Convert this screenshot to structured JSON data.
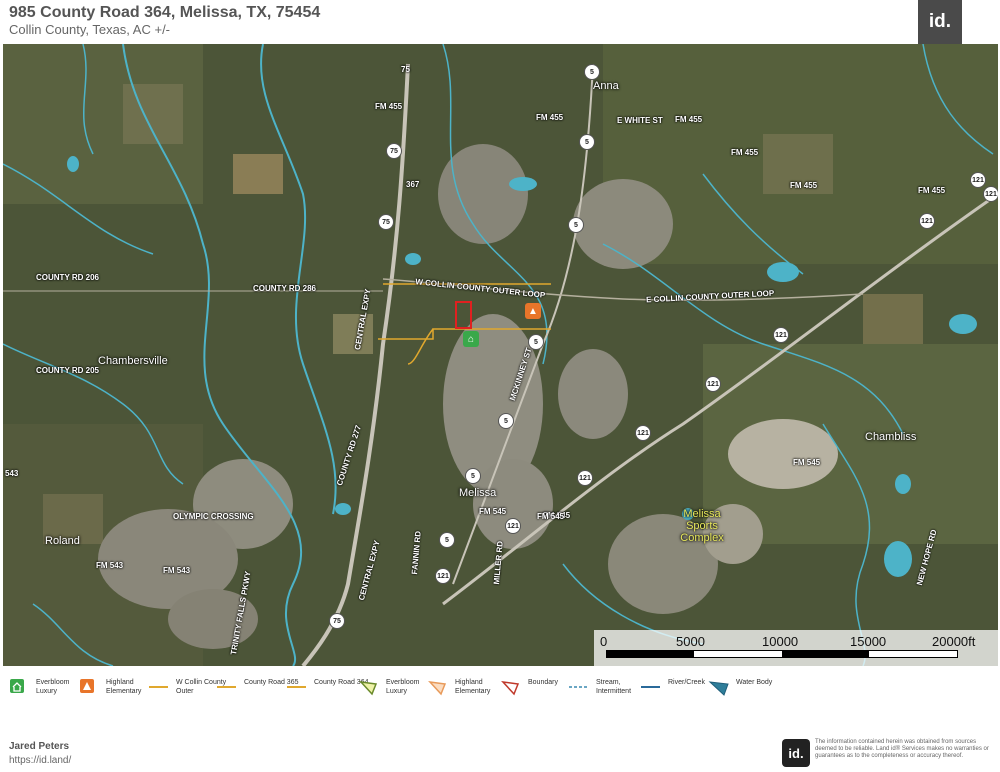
{
  "header": {
    "title": "985 County Road 364, Melissa, TX, 75454",
    "subtitle": "Collin County, Texas,  AC +/-",
    "logo": "id."
  },
  "map": {
    "road_labels": [
      {
        "text": "75"
      },
      {
        "text": "FM 455"
      },
      {
        "text": "FM 455"
      },
      {
        "text": "E WHITE ST"
      },
      {
        "text": "FM 455"
      },
      {
        "text": "FM 455"
      },
      {
        "text": "FM 455"
      },
      {
        "text": "FM 455"
      },
      {
        "text": "367"
      },
      {
        "text": "COUNTY RD 206"
      },
      {
        "text": "COUNTY RD 286"
      },
      {
        "text": "W COLLIN COUNTY OUTER LOOP"
      },
      {
        "text": "E COLLIN COUNTY OUTER LOOP"
      },
      {
        "text": "COUNTY RD 205"
      },
      {
        "text": "CENTRAL EXPY"
      },
      {
        "text": "MCKINNEY ST"
      },
      {
        "text": "COUNTY RD 277"
      },
      {
        "text": "FM 545"
      },
      {
        "text": "FM 545"
      },
      {
        "text": "FM 545"
      },
      {
        "text": "FM 543"
      },
      {
        "text": "FM 543"
      },
      {
        "text": "543"
      },
      {
        "text": "OLYMPIC CROSSING"
      },
      {
        "text": "FANNIN RD"
      },
      {
        "text": "MILLER RD"
      },
      {
        "text": "TRINITY FALLS PKWY"
      },
      {
        "text": "NEW HOPE RD"
      },
      {
        "text": "CENTRAL EXPY"
      },
      {
        "text": "FM 545"
      }
    ],
    "shields": [
      {
        "text": "5"
      },
      {
        "text": "5"
      },
      {
        "text": "5"
      },
      {
        "text": "5"
      },
      {
        "text": "5"
      },
      {
        "text": "5"
      },
      {
        "text": "5"
      },
      {
        "text": "121"
      },
      {
        "text": "121"
      },
      {
        "text": "121"
      },
      {
        "text": "121"
      },
      {
        "text": "121"
      },
      {
        "text": "121"
      },
      {
        "text": "121"
      },
      {
        "text": "121"
      },
      {
        "text": "121"
      },
      {
        "text": "75"
      },
      {
        "text": "75"
      },
      {
        "text": "75"
      }
    ],
    "places": [
      {
        "text": "Anna"
      },
      {
        "text": "Chambersville"
      },
      {
        "text": "Chambliss"
      },
      {
        "text": "Melissa"
      },
      {
        "text": "Roland"
      },
      {
        "text": "Melissa Sports Complex"
      }
    ],
    "poi": [
      {
        "name": "Everbloom Luxury",
        "color": "#3aa84a",
        "icon": "home-icon"
      },
      {
        "name": "Highland Elementary",
        "color": "#e8752a",
        "icon": "school-icon"
      }
    ]
  },
  "scale": {
    "ticks": [
      "0",
      "5000",
      "10000",
      "15000",
      "20000ft"
    ]
  },
  "legend": [
    {
      "label": "Everbloom Luxury",
      "kind": "point",
      "color": "#3aa84a"
    },
    {
      "label": "Highland Elementary",
      "kind": "point",
      "color": "#e8752a"
    },
    {
      "label": "W Collin County Outer",
      "kind": "line",
      "color": "#e0a82e"
    },
    {
      "label": "County Road 365",
      "kind": "line",
      "color": "#e0a82e"
    },
    {
      "label": "County Road 364",
      "kind": "line",
      "color": "#e0a82e"
    },
    {
      "label": "Everbloom Luxury",
      "kind": "polygon",
      "color": "#c8d23a"
    },
    {
      "label": "Highland Elementary",
      "kind": "polygon",
      "color": "#f4b27a"
    },
    {
      "label": "Boundary",
      "kind": "polygon",
      "color": "#c0392b"
    },
    {
      "label": "Stream, Intermittent",
      "kind": "line",
      "color": "#3a8ab0"
    },
    {
      "label": "River/Creek",
      "kind": "line",
      "color": "#2a6a9a"
    },
    {
      "label": "Water Body",
      "kind": "polygon",
      "color": "#2f7e9a"
    }
  ],
  "footer": {
    "name": "Jared Peters",
    "url": "https://id.land/",
    "logo": "id.",
    "disclaimer": "The information contained herein was obtained from sources deemed to be reliable. Land id® Services makes no warranties or guarantees as to the completeness or accuracy thereof."
  }
}
